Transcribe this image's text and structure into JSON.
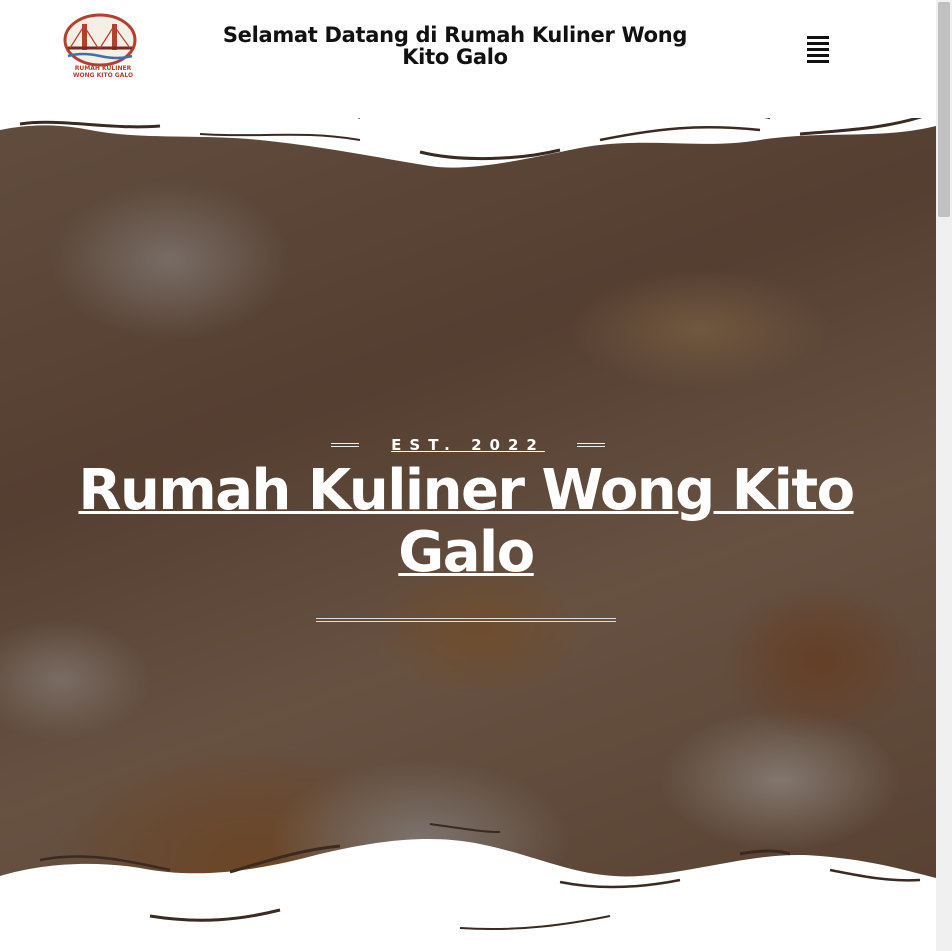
{
  "header": {
    "title": "Selamat Datang di Rumah Kuliner Wong Kito Galo",
    "logo_text_line1": "RUMAH KULINER",
    "logo_text_line2": "WONG KITO GALO"
  },
  "hero": {
    "established": "EST. 2022",
    "title": "Rumah Kuliner Wong Kito Galo"
  },
  "icons": {
    "menu": "hamburger-menu-icon",
    "logo": "ampera-bridge-logo"
  },
  "colors": {
    "wave_stroke": "#3a2a22",
    "logo_accent": "#b3402f"
  }
}
